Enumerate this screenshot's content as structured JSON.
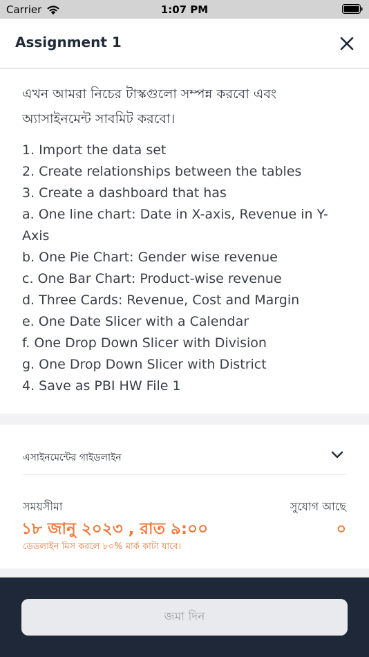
{
  "status_bar": {
    "carrier": "Carrier",
    "time": "1:07 PM"
  },
  "header": {
    "title": "Assignment 1"
  },
  "instructions": {
    "intro": "এখন আমরা নিচের টাস্কগুলো সম্পন্ন করবো এবং অ্যাসাইনমেন্ট সাবমিট করবো।",
    "steps": [
      "1. Import the data set",
      "2. Create relationships between the tables",
      "3. Create a dashboard that has",
      "a. One line chart: Date in X-axis, Revenue in Y-Axis",
      "b. One Pie Chart: Gender wise revenue",
      "c. One Bar Chart: Product-wise revenue",
      "d. Three Cards: Revenue, Cost and Margin",
      "e. One Date Slicer with a Calendar",
      "f. One Drop Down Slicer with Division",
      "g. One Drop Down Slicer with District",
      "4. Save as PBI HW File 1"
    ]
  },
  "guideline": {
    "label": "এসাইনমেন্টের গাইডলাইন"
  },
  "deadline": {
    "label": "সময়সীমা",
    "value": "১৮ জানু ২০২৩ , রাত ৯:০০",
    "note": "ডেডলাইন মিস করলে ৮০% মার্ক কাটা যাবে।"
  },
  "chance": {
    "label": "সুযোগ আছে",
    "value": "০"
  },
  "footer": {
    "submit_label": "জমা দিন"
  },
  "colors": {
    "accent": "#f2793a",
    "footer_bg": "#1f2838",
    "text": "#3a3f47"
  }
}
